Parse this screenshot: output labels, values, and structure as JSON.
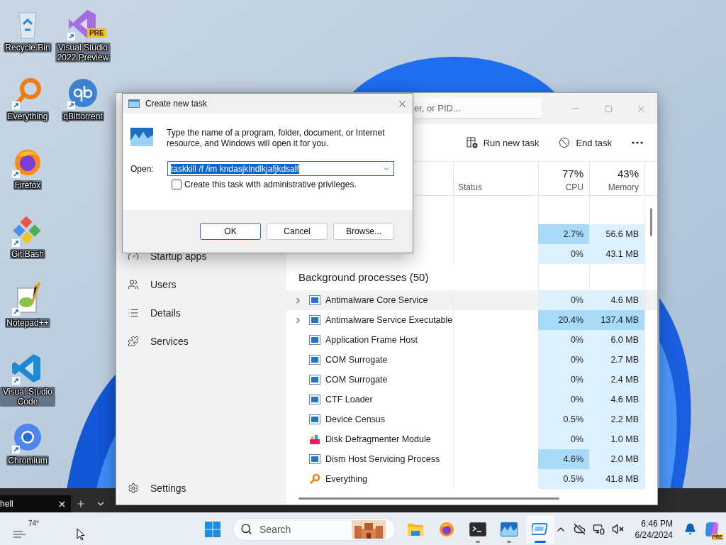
{
  "desktop": {
    "icon_columns": [
      {
        "icons": [
          {
            "label": "Recycle Bin",
            "kind": "recycle",
            "shortcut": false
          },
          {
            "label": "Everything",
            "kind": "everything",
            "shortcut": true
          },
          {
            "label": "Firefox",
            "kind": "firefox",
            "shortcut": true
          },
          {
            "label": "Git Bash",
            "kind": "gitbash",
            "shortcut": true
          },
          {
            "label": "Notepad++",
            "kind": "notepad",
            "shortcut": true
          },
          {
            "label": "Visual Studio Code",
            "kind": "vscode",
            "shortcut": true
          },
          {
            "label": "Chromium",
            "kind": "chromium",
            "shortcut": true
          }
        ]
      },
      {
        "icons": [
          {
            "label": "Visual Studio 2022 Preview",
            "kind": "vs",
            "shortcut": true,
            "badge": "PRE"
          },
          {
            "label": "qBittorrent",
            "kind": "qbittorrent",
            "shortcut": true
          }
        ]
      }
    ]
  },
  "terminal_strip": {
    "tab": {
      "label": "hell"
    }
  },
  "task_manager": {
    "search": {
      "placeholder": "er, or PID..."
    },
    "commands": [
      {
        "label": "Run new task",
        "kind": "run"
      },
      {
        "label": "End task",
        "kind": "end"
      }
    ],
    "nav": [
      {
        "label": "Startup apps",
        "kind": "startup"
      },
      {
        "label": "Users",
        "kind": "users"
      },
      {
        "label": "Details",
        "kind": "details"
      },
      {
        "label": "Services",
        "kind": "services"
      }
    ],
    "footer_nav": {
      "label": "Settings"
    },
    "columns": [
      {
        "label": "Status"
      },
      {
        "label": "CPU",
        "total": "77%"
      },
      {
        "label": "Memory",
        "total": "43%"
      }
    ],
    "app_rows": [
      {
        "cpu": "2.7%",
        "memory": "56.6 MB",
        "cpu_high": true,
        "memory_high": false
      },
      {
        "cpu": "0%",
        "memory": "43.1 MB",
        "cpu_high": false,
        "memory_high": false
      }
    ],
    "group": {
      "label": "Background processes (50)"
    },
    "processes": [
      {
        "name": "Antimalware Core Service",
        "kind": "app",
        "expandable": true,
        "hovered": true,
        "cpu": "0%",
        "memory": "4.6 MB",
        "cpu_high": false,
        "memory_high": false
      },
      {
        "name": "Antimalware Service Executable",
        "kind": "app",
        "expandable": true,
        "hovered": false,
        "cpu": "20.4%",
        "memory": "137.4 MB",
        "cpu_high": true,
        "memory_high": true
      },
      {
        "name": "Application Frame Host",
        "kind": "app",
        "expandable": false,
        "hovered": false,
        "cpu": "0%",
        "memory": "6.0 MB",
        "cpu_high": false,
        "memory_high": false
      },
      {
        "name": "COM Surrogate",
        "kind": "app",
        "expandable": false,
        "hovered": false,
        "cpu": "0%",
        "memory": "2.7 MB",
        "cpu_high": false,
        "memory_high": false
      },
      {
        "name": "COM Surrogate",
        "kind": "app",
        "expandable": false,
        "hovered": false,
        "cpu": "0%",
        "memory": "2.4 MB",
        "cpu_high": false,
        "memory_high": false
      },
      {
        "name": "CTF Loader",
        "kind": "app",
        "expandable": false,
        "hovered": false,
        "cpu": "0%",
        "memory": "4.6 MB",
        "cpu_high": false,
        "memory_high": false
      },
      {
        "name": "Device Census",
        "kind": "app",
        "expandable": false,
        "hovered": false,
        "cpu": "0.5%",
        "memory": "2.2 MB",
        "cpu_high": false,
        "memory_high": false
      },
      {
        "name": "Disk Defragmenter Module",
        "kind": "defrag",
        "expandable": false,
        "hovered": false,
        "cpu": "0%",
        "memory": "1.0 MB",
        "cpu_high": false,
        "memory_high": false
      },
      {
        "name": "Dism Host Servicing Process",
        "kind": "app",
        "expandable": false,
        "hovered": false,
        "cpu": "4.6%",
        "memory": "2.0 MB",
        "cpu_high": true,
        "memory_high": false
      },
      {
        "name": "Everything",
        "kind": "everything",
        "expandable": false,
        "hovered": false,
        "cpu": "0.5%",
        "memory": "41.8 MB",
        "cpu_high": false,
        "memory_high": false
      }
    ]
  },
  "dialog": {
    "title": "Create new task",
    "message": "Type the name of a program, folder, document, or Internet resource, and Windows will open it for you.",
    "open_label": "Open:",
    "value": "taskkill /f /im kndasjklndlkjafjkdsalf",
    "value_selected": true,
    "checkbox": {
      "label": "Create this task with administrative privileges.",
      "checked": false
    },
    "buttons": [
      {
        "label": "OK",
        "default": true
      },
      {
        "label": "Cancel",
        "default": false
      },
      {
        "label": "Browse...",
        "default": false
      }
    ]
  },
  "taskbar": {
    "weather": "74°",
    "search": {
      "placeholder": "Search"
    },
    "apps": [
      {
        "kind": "explorer",
        "running": false,
        "active": false
      },
      {
        "kind": "firefox",
        "running": false,
        "active": false
      },
      {
        "kind": "terminal",
        "running": true,
        "active": false
      },
      {
        "kind": "wave",
        "running": true,
        "active": false
      },
      {
        "kind": "taskmgr",
        "running": true,
        "active": true
      }
    ],
    "time": "6:46 PM",
    "date": "6/24/2024",
    "copilot_badge": "PRE"
  }
}
